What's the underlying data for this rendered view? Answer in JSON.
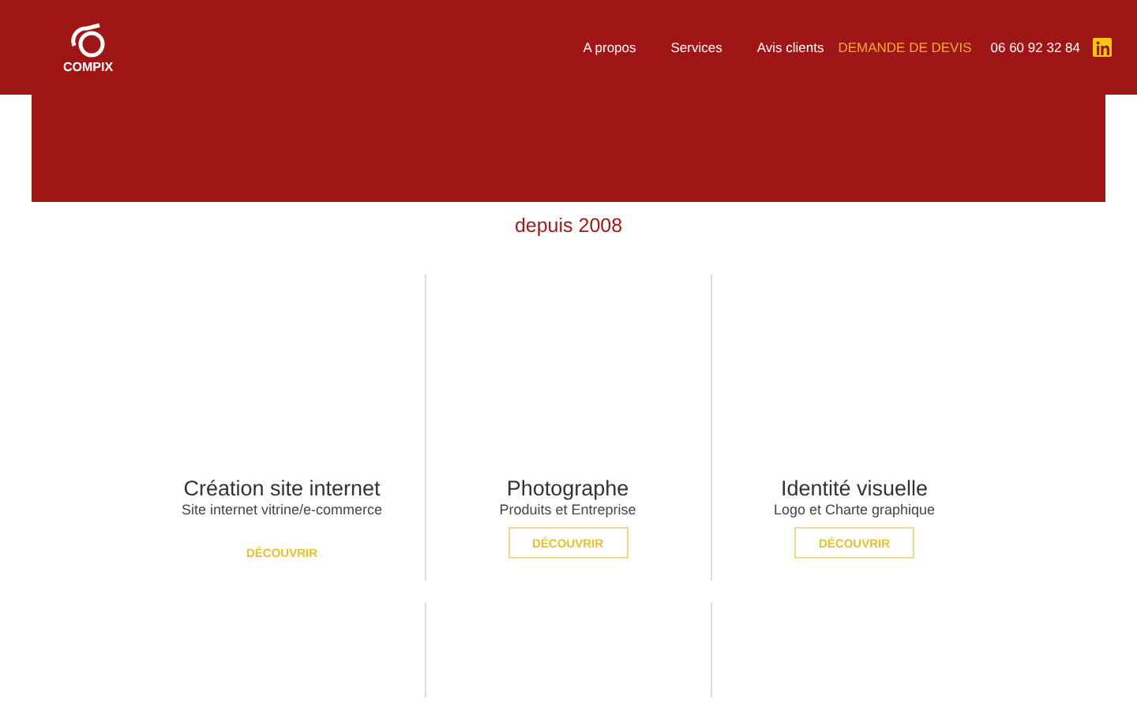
{
  "header": {
    "logo_text": "COMPIX",
    "nav": [
      {
        "label": "A propos",
        "highlighted": false
      },
      {
        "label": "Services",
        "highlighted": false
      },
      {
        "label": "Avis clients",
        "highlighted": false
      },
      {
        "label": "DEMANDE DE DEVIS",
        "highlighted": true
      }
    ],
    "phone": "06 60 92 32 84"
  },
  "tagline": "depuis 2008",
  "services": [
    {
      "title": "Création site internet",
      "subtitle": "Site internet vitrine/e-commerce",
      "button": "DÉCOUVRIR",
      "outlined": false
    },
    {
      "title": "Photographe",
      "subtitle": "Produits et Entreprise",
      "button": "DÉCOUVRIR",
      "outlined": true
    },
    {
      "title": "Identité visuelle",
      "subtitle": "Logo et Charte graphique",
      "button": "DÉCOUVRIR",
      "outlined": true
    }
  ]
}
